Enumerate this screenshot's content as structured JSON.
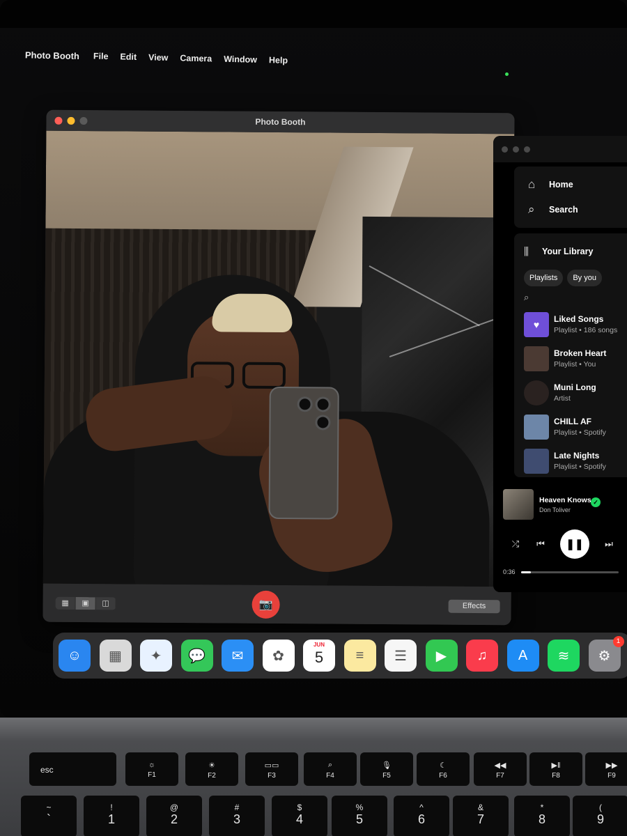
{
  "menubar": {
    "apple_icon": "apple-logo-icon",
    "app_name": "Photo Booth",
    "items": [
      "File",
      "Edit",
      "View",
      "Camera",
      "Window",
      "Help"
    ]
  },
  "photo_booth": {
    "title": "Photo Booth",
    "view_modes": [
      "grid-view-icon",
      "single-view-icon",
      "filmstrip-view-icon"
    ],
    "active_view_mode": "single-view-icon",
    "shutter_icon": "camera-icon",
    "effects_label": "Effects"
  },
  "spotify": {
    "nav": [
      {
        "icon": "home-icon",
        "glyph": "⌂",
        "label": "Home"
      },
      {
        "icon": "search-icon",
        "glyph": "⌕",
        "label": "Search"
      }
    ],
    "library": {
      "title": "Your Library",
      "chips": [
        "Playlists",
        "By you"
      ],
      "items": [
        {
          "name": "Liked Songs",
          "subtitle": "Playlist • 186 songs",
          "thumb": "#6f4fd8",
          "glyph": "♥"
        },
        {
          "name": "Broken Heart",
          "subtitle": "Playlist • You",
          "thumb": "#4b3a33",
          "glyph": ""
        },
        {
          "name": "Muni Long",
          "subtitle": "Artist",
          "thumb": "#2a2220",
          "glyph": ""
        },
        {
          "name": "CHILL AF",
          "subtitle": "Playlist • Spotify",
          "thumb": "#6d86a8",
          "glyph": ""
        },
        {
          "name": "Late Nights",
          "subtitle": "Playlist • Spotify",
          "thumb": "#3f4c70",
          "glyph": ""
        }
      ]
    },
    "now_playing": {
      "title": "Heaven Knows",
      "artist": "Don Toliver",
      "current_time": "0:36",
      "progress": 0.1
    }
  },
  "dock": {
    "apps": [
      {
        "name": "finder-icon",
        "color": "#2a86f0",
        "glyph": "☺"
      },
      {
        "name": "launchpad-icon",
        "color": "#d9d9d9",
        "glyph": "▦"
      },
      {
        "name": "safari-icon",
        "color": "#e8f2ff",
        "glyph": "✦"
      },
      {
        "name": "messages-icon",
        "color": "#34c759",
        "glyph": "💬"
      },
      {
        "name": "mail-icon",
        "color": "#2b8ff5",
        "glyph": "✉"
      },
      {
        "name": "photos-icon",
        "color": "#ffffff",
        "glyph": "✿"
      },
      {
        "name": "calendar-icon",
        "color": "#ffffff",
        "glyph": ""
      },
      {
        "name": "notes-icon",
        "color": "#fbe9a0",
        "glyph": "≡"
      },
      {
        "name": "reminders-icon",
        "color": "#f6f6f6",
        "glyph": "☰"
      },
      {
        "name": "facetime-icon",
        "color": "#32c852",
        "glyph": "▶"
      },
      {
        "name": "music-icon",
        "color": "#fa3c4c",
        "glyph": "♫"
      },
      {
        "name": "app-store-icon",
        "color": "#1e8cf5",
        "glyph": "A"
      },
      {
        "name": "spotify-icon",
        "color": "#1ed760",
        "glyph": "≋"
      },
      {
        "name": "system-settings-icon",
        "color": "#8a8a8e",
        "glyph": "⚙",
        "badge": "1"
      }
    ],
    "calendar": {
      "month": "JUN",
      "day": "5"
    }
  },
  "keyboard": {
    "fn_row": [
      {
        "label": "esc",
        "icon": ""
      },
      {
        "label": "F1",
        "icon": "☼"
      },
      {
        "label": "F2",
        "icon": "☀"
      },
      {
        "label": "F3",
        "icon": "▭▭"
      },
      {
        "label": "F4",
        "icon": "⌕"
      },
      {
        "label": "F5",
        "icon": "🎙"
      },
      {
        "label": "F6",
        "icon": "☾"
      },
      {
        "label": "F7",
        "icon": "◀◀"
      },
      {
        "label": "F8",
        "icon": "▶‖"
      },
      {
        "label": "F9",
        "icon": "▶▶"
      }
    ],
    "num_row": [
      {
        "top": "~",
        "bottom": "`"
      },
      {
        "top": "!",
        "bottom": "1"
      },
      {
        "top": "@",
        "bottom": "2"
      },
      {
        "top": "#",
        "bottom": "3"
      },
      {
        "top": "$",
        "bottom": "4"
      },
      {
        "top": "%",
        "bottom": "5"
      },
      {
        "top": "^",
        "bottom": "6"
      },
      {
        "top": "&",
        "bottom": "7"
      },
      {
        "top": "*",
        "bottom": "8"
      },
      {
        "top": "(",
        "bottom": "9"
      }
    ]
  }
}
